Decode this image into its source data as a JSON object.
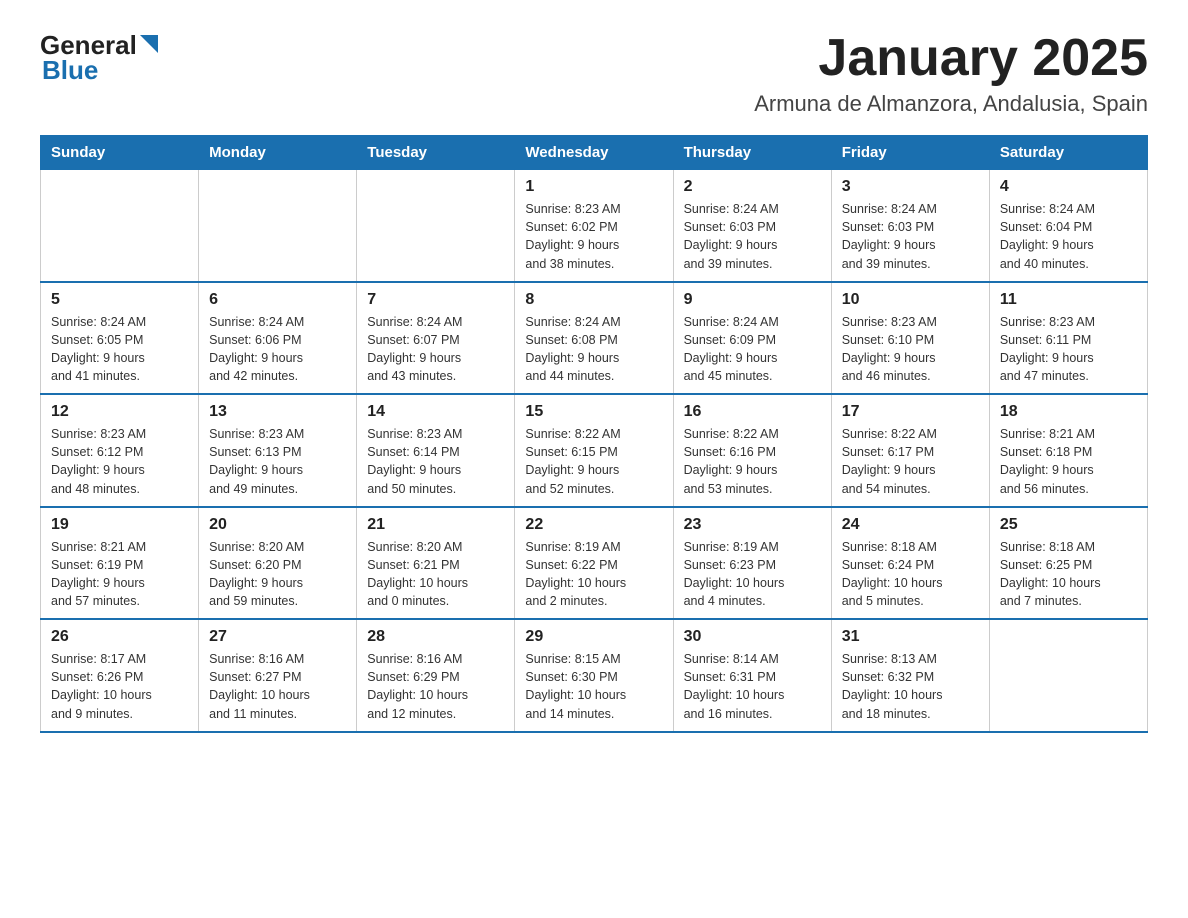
{
  "logo": {
    "text_general": "General",
    "text_blue": "Blue"
  },
  "title": "January 2025",
  "subtitle": "Armuna de Almanzora, Andalusia, Spain",
  "headers": [
    "Sunday",
    "Monday",
    "Tuesday",
    "Wednesday",
    "Thursday",
    "Friday",
    "Saturday"
  ],
  "weeks": [
    [
      {
        "day": "",
        "info": ""
      },
      {
        "day": "",
        "info": ""
      },
      {
        "day": "",
        "info": ""
      },
      {
        "day": "1",
        "info": "Sunrise: 8:23 AM\nSunset: 6:02 PM\nDaylight: 9 hours\nand 38 minutes."
      },
      {
        "day": "2",
        "info": "Sunrise: 8:24 AM\nSunset: 6:03 PM\nDaylight: 9 hours\nand 39 minutes."
      },
      {
        "day": "3",
        "info": "Sunrise: 8:24 AM\nSunset: 6:03 PM\nDaylight: 9 hours\nand 39 minutes."
      },
      {
        "day": "4",
        "info": "Sunrise: 8:24 AM\nSunset: 6:04 PM\nDaylight: 9 hours\nand 40 minutes."
      }
    ],
    [
      {
        "day": "5",
        "info": "Sunrise: 8:24 AM\nSunset: 6:05 PM\nDaylight: 9 hours\nand 41 minutes."
      },
      {
        "day": "6",
        "info": "Sunrise: 8:24 AM\nSunset: 6:06 PM\nDaylight: 9 hours\nand 42 minutes."
      },
      {
        "day": "7",
        "info": "Sunrise: 8:24 AM\nSunset: 6:07 PM\nDaylight: 9 hours\nand 43 minutes."
      },
      {
        "day": "8",
        "info": "Sunrise: 8:24 AM\nSunset: 6:08 PM\nDaylight: 9 hours\nand 44 minutes."
      },
      {
        "day": "9",
        "info": "Sunrise: 8:24 AM\nSunset: 6:09 PM\nDaylight: 9 hours\nand 45 minutes."
      },
      {
        "day": "10",
        "info": "Sunrise: 8:23 AM\nSunset: 6:10 PM\nDaylight: 9 hours\nand 46 minutes."
      },
      {
        "day": "11",
        "info": "Sunrise: 8:23 AM\nSunset: 6:11 PM\nDaylight: 9 hours\nand 47 minutes."
      }
    ],
    [
      {
        "day": "12",
        "info": "Sunrise: 8:23 AM\nSunset: 6:12 PM\nDaylight: 9 hours\nand 48 minutes."
      },
      {
        "day": "13",
        "info": "Sunrise: 8:23 AM\nSunset: 6:13 PM\nDaylight: 9 hours\nand 49 minutes."
      },
      {
        "day": "14",
        "info": "Sunrise: 8:23 AM\nSunset: 6:14 PM\nDaylight: 9 hours\nand 50 minutes."
      },
      {
        "day": "15",
        "info": "Sunrise: 8:22 AM\nSunset: 6:15 PM\nDaylight: 9 hours\nand 52 minutes."
      },
      {
        "day": "16",
        "info": "Sunrise: 8:22 AM\nSunset: 6:16 PM\nDaylight: 9 hours\nand 53 minutes."
      },
      {
        "day": "17",
        "info": "Sunrise: 8:22 AM\nSunset: 6:17 PM\nDaylight: 9 hours\nand 54 minutes."
      },
      {
        "day": "18",
        "info": "Sunrise: 8:21 AM\nSunset: 6:18 PM\nDaylight: 9 hours\nand 56 minutes."
      }
    ],
    [
      {
        "day": "19",
        "info": "Sunrise: 8:21 AM\nSunset: 6:19 PM\nDaylight: 9 hours\nand 57 minutes."
      },
      {
        "day": "20",
        "info": "Sunrise: 8:20 AM\nSunset: 6:20 PM\nDaylight: 9 hours\nand 59 minutes."
      },
      {
        "day": "21",
        "info": "Sunrise: 8:20 AM\nSunset: 6:21 PM\nDaylight: 10 hours\nand 0 minutes."
      },
      {
        "day": "22",
        "info": "Sunrise: 8:19 AM\nSunset: 6:22 PM\nDaylight: 10 hours\nand 2 minutes."
      },
      {
        "day": "23",
        "info": "Sunrise: 8:19 AM\nSunset: 6:23 PM\nDaylight: 10 hours\nand 4 minutes."
      },
      {
        "day": "24",
        "info": "Sunrise: 8:18 AM\nSunset: 6:24 PM\nDaylight: 10 hours\nand 5 minutes."
      },
      {
        "day": "25",
        "info": "Sunrise: 8:18 AM\nSunset: 6:25 PM\nDaylight: 10 hours\nand 7 minutes."
      }
    ],
    [
      {
        "day": "26",
        "info": "Sunrise: 8:17 AM\nSunset: 6:26 PM\nDaylight: 10 hours\nand 9 minutes."
      },
      {
        "day": "27",
        "info": "Sunrise: 8:16 AM\nSunset: 6:27 PM\nDaylight: 10 hours\nand 11 minutes."
      },
      {
        "day": "28",
        "info": "Sunrise: 8:16 AM\nSunset: 6:29 PM\nDaylight: 10 hours\nand 12 minutes."
      },
      {
        "day": "29",
        "info": "Sunrise: 8:15 AM\nSunset: 6:30 PM\nDaylight: 10 hours\nand 14 minutes."
      },
      {
        "day": "30",
        "info": "Sunrise: 8:14 AM\nSunset: 6:31 PM\nDaylight: 10 hours\nand 16 minutes."
      },
      {
        "day": "31",
        "info": "Sunrise: 8:13 AM\nSunset: 6:32 PM\nDaylight: 10 hours\nand 18 minutes."
      },
      {
        "day": "",
        "info": ""
      }
    ]
  ]
}
